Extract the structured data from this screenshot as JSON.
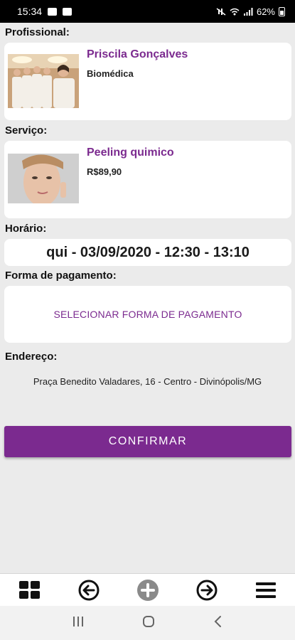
{
  "status_bar": {
    "time": "15:34",
    "battery": "62%"
  },
  "professional": {
    "section_label": "Profissional:",
    "name": "Priscila Gonçalves",
    "role": "Biomédica"
  },
  "service": {
    "section_label": "Serviço:",
    "name": "Peeling quimico",
    "price": "R$89,90"
  },
  "schedule": {
    "section_label": "Horário:",
    "value": "qui - 03/09/2020 - 12:30 - 13:10"
  },
  "payment": {
    "section_label": "Forma de pagamento:",
    "select_label": "SELECIONAR FORMA DE PAGAMENTO"
  },
  "address": {
    "section_label": "Endereço:",
    "value": "Praça Benedito Valadares, 16 - Centro - Divinópolis/MG"
  },
  "confirm_label": "CONFIRMAR",
  "bottom_nav": {
    "icons": [
      "grid-icon",
      "back-arrow-icon",
      "plus-icon",
      "forward-arrow-icon",
      "menu-icon"
    ]
  },
  "colors": {
    "accent": "#7b2a8f",
    "background": "#ebebeb"
  }
}
